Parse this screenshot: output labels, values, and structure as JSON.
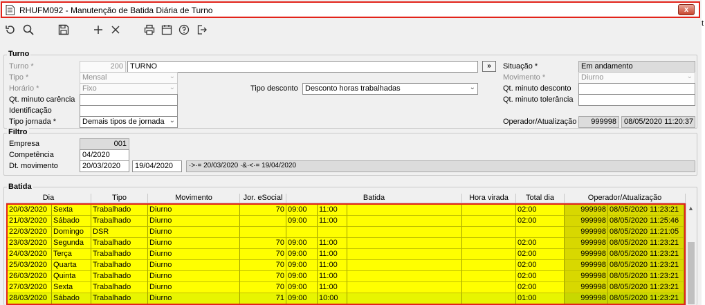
{
  "window": {
    "title": "RHUFM092 - Manutenção de Batida Diária de Turno",
    "close_label": "x"
  },
  "toolbar": {
    "icons": [
      "undo-icon",
      "search-icon",
      "save-icon",
      "add-icon",
      "delete-icon",
      "print-icon",
      "calendar-icon",
      "help-icon",
      "exit-icon"
    ]
  },
  "turno": {
    "section_title": "Turno",
    "turno_label": "Turno *",
    "turno_code": "200",
    "turno_name": "TURNO",
    "go_label": "»",
    "tipo_label": "Tipo *",
    "tipo_value": "Mensal",
    "horario_label": "Horário *",
    "horario_value": "Fixo",
    "qt_carencia_label": "Qt. minuto carência",
    "qt_carencia_value": "",
    "identificacao_label": "Identificação",
    "identificacao_value": "",
    "tipo_jornada_label": "Tipo jornada *",
    "tipo_jornada_value": "Demais tipos de jornada",
    "tipo_desconto_label": "Tipo desconto",
    "tipo_desconto_value": "Desconto horas trabalhadas",
    "situacao_label": "Situação *",
    "situacao_value": "Em andamento",
    "movimento_label": "Movimento *",
    "movimento_value": "Diurno",
    "qt_desconto_label": "Qt. minuto desconto",
    "qt_desconto_value": "",
    "qt_tolerancia_label": "Qt. minuto tolerância",
    "qt_tolerancia_value": "",
    "operador_label": "Operador/Atualização",
    "operador_value": "999998",
    "atualizacao_value": "08/05/2020 11:20:37"
  },
  "filtro": {
    "section_title": "Filtro",
    "empresa_label": "Empresa",
    "empresa_value": "001",
    "competencia_label": "Competência",
    "competencia_value": "04/2020",
    "dt_movimento_label": "Dt. movimento",
    "dt_inicio": "20/03/2020",
    "dt_fim": "19/04/2020",
    "filter_expression": "·>·= 20/03/2020 ·&·<·= 19/04/2020"
  },
  "batida": {
    "section_title": "Batida",
    "columns": [
      "Dia",
      "Tipo",
      "Movimento",
      "Jor. eSocial",
      "Batida",
      "Hora virada",
      "Total dia",
      "Operador/Atualização"
    ],
    "rows": [
      {
        "data": "20/03/2020",
        "dia": "Sexta",
        "tipo": "Trabalhado",
        "movimento": "Diurno",
        "jor": "70",
        "b1": "09:00",
        "b2": "11:00",
        "hora_virada": "",
        "total": "02:00",
        "operador": "999998",
        "atualizacao": "08/05/2020 11:23:21"
      },
      {
        "data": "21/03/2020",
        "dia": "Sábado",
        "tipo": "Trabalhado",
        "movimento": "Diurno",
        "jor": "",
        "b1": "09:00",
        "b2": "11:00",
        "hora_virada": "",
        "total": "02:00",
        "operador": "999998",
        "atualizacao": "08/05/2020 11:25:46"
      },
      {
        "data": "22/03/2020",
        "dia": "Domingo",
        "tipo": "DSR",
        "movimento": "Diurno",
        "jor": "",
        "b1": "",
        "b2": "",
        "hora_virada": "",
        "total": "",
        "operador": "999998",
        "atualizacao": "08/05/2020 11:21:05"
      },
      {
        "data": "23/03/2020",
        "dia": "Segunda",
        "tipo": "Trabalhado",
        "movimento": "Diurno",
        "jor": "70",
        "b1": "09:00",
        "b2": "11:00",
        "hora_virada": "",
        "total": "02:00",
        "operador": "999998",
        "atualizacao": "08/05/2020 11:23:21"
      },
      {
        "data": "24/03/2020",
        "dia": "Terça",
        "tipo": "Trabalhado",
        "movimento": "Diurno",
        "jor": "70",
        "b1": "09:00",
        "b2": "11:00",
        "hora_virada": "",
        "total": "02:00",
        "operador": "999998",
        "atualizacao": "08/05/2020 11:23:21"
      },
      {
        "data": "25/03/2020",
        "dia": "Quarta",
        "tipo": "Trabalhado",
        "movimento": "Diurno",
        "jor": "70",
        "b1": "09:00",
        "b2": "11:00",
        "hora_virada": "",
        "total": "02:00",
        "operador": "999998",
        "atualizacao": "08/05/2020 11:23:21"
      },
      {
        "data": "26/03/2020",
        "dia": "Quinta",
        "tipo": "Trabalhado",
        "movimento": "Diurno",
        "jor": "70",
        "b1": "09:00",
        "b2": "11:00",
        "hora_virada": "",
        "total": "02:00",
        "operador": "999998",
        "atualizacao": "08/05/2020 11:23:21"
      },
      {
        "data": "27/03/2020",
        "dia": "Sexta",
        "tipo": "Trabalhado",
        "movimento": "Diurno",
        "jor": "70",
        "b1": "09:00",
        "b2": "11:00",
        "hora_virada": "",
        "total": "02:00",
        "operador": "999998",
        "atualizacao": "08/05/2020 11:23:21"
      },
      {
        "data": "28/03/2020",
        "dia": "Sábado",
        "tipo": "Trabalhado",
        "movimento": "Diurno",
        "jor": "71",
        "b1": "09:00",
        "b2": "10:00",
        "hora_virada": "",
        "total": "01:00",
        "operador": "999998",
        "atualizacao": "08/05/2020 11:23:21"
      }
    ]
  },
  "edge_text": "t"
}
